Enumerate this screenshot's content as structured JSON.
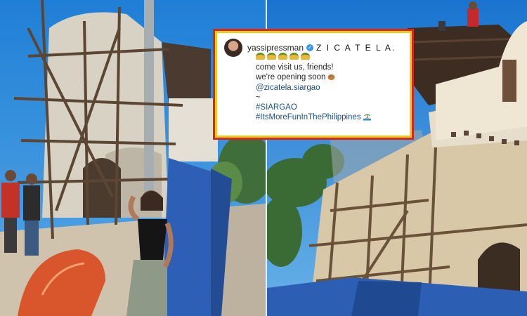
{
  "caption": {
    "username": "yassipressman",
    "brand": "Z I C A T E L A.",
    "emoji_count": 5,
    "line1": "come visit us, friends!",
    "line2": "we're opening soon",
    "mention": "@zicatela.siargao",
    "tilde": "~",
    "hashtag1": "#SIARGAO",
    "hashtag2": "#ItsMoreFunInThePhilippines"
  },
  "colors": {
    "card_border_outer": "#d42a1c",
    "card_border_inner": "#f2c919",
    "link": "#1b4f8a"
  }
}
